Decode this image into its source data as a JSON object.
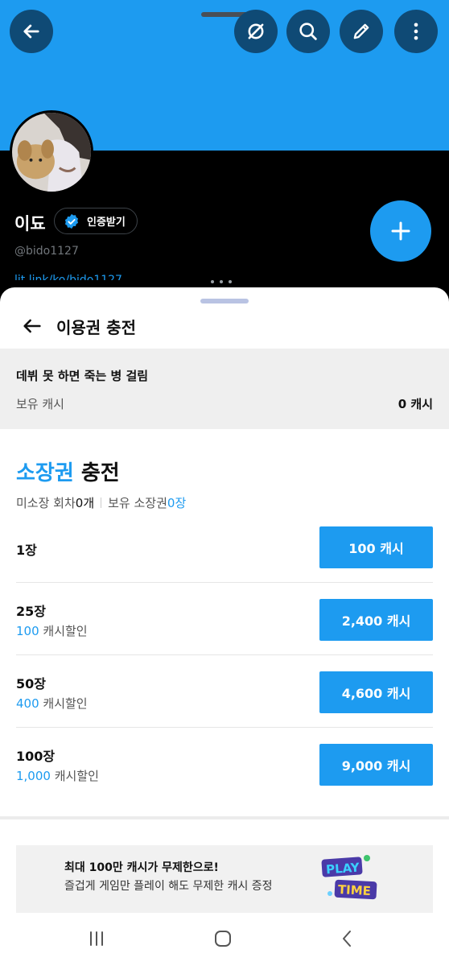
{
  "profile": {
    "display_name": "이됴",
    "verify_label": "인증받기",
    "handle": "@bido1127",
    "bio_link": "lit.link/ko/bido1127"
  },
  "top_actions": {
    "icons": [
      "back-arrow-icon",
      "unfollow-icon",
      "search-icon",
      "edit-icon",
      "more-vertical-icon"
    ]
  },
  "sheet": {
    "title": "이용권 충전",
    "series_title": "데뷔 못 하면 죽는 병 걸림",
    "cash_label": "보유 캐시",
    "cash_value": "0 캐시",
    "section_title_accent": "소장권",
    "section_title_rest": " 충전",
    "unowned_label": "미소장 회차 ",
    "unowned_value": "0개",
    "owned_label": "보유 소장권 ",
    "owned_value": "0장",
    "options": [
      {
        "qty": "1장",
        "discount_value": "",
        "discount_label": "",
        "price": "100 캐시"
      },
      {
        "qty": "25장",
        "discount_value": "100",
        "discount_label": " 캐시할인",
        "price": "2,400 캐시"
      },
      {
        "qty": "50장",
        "discount_value": "400",
        "discount_label": " 캐시할인",
        "price": "4,600 캐시"
      },
      {
        "qty": "100장",
        "discount_value": "1,000",
        "discount_label": " 캐시할인",
        "price": "9,000 캐시"
      }
    ],
    "promo_line1": "최대 100만 캐시가 무제한으로!",
    "promo_line2": "즐겁게 게임만 플레이 해도 무제한 캐시 증정",
    "promo_logo_top": "PLAY",
    "promo_logo_bottom": "TIME"
  },
  "colors": {
    "accent": "#1d9bf0",
    "banner": "#1d9bf0",
    "icon_button": "#0f4a75"
  }
}
